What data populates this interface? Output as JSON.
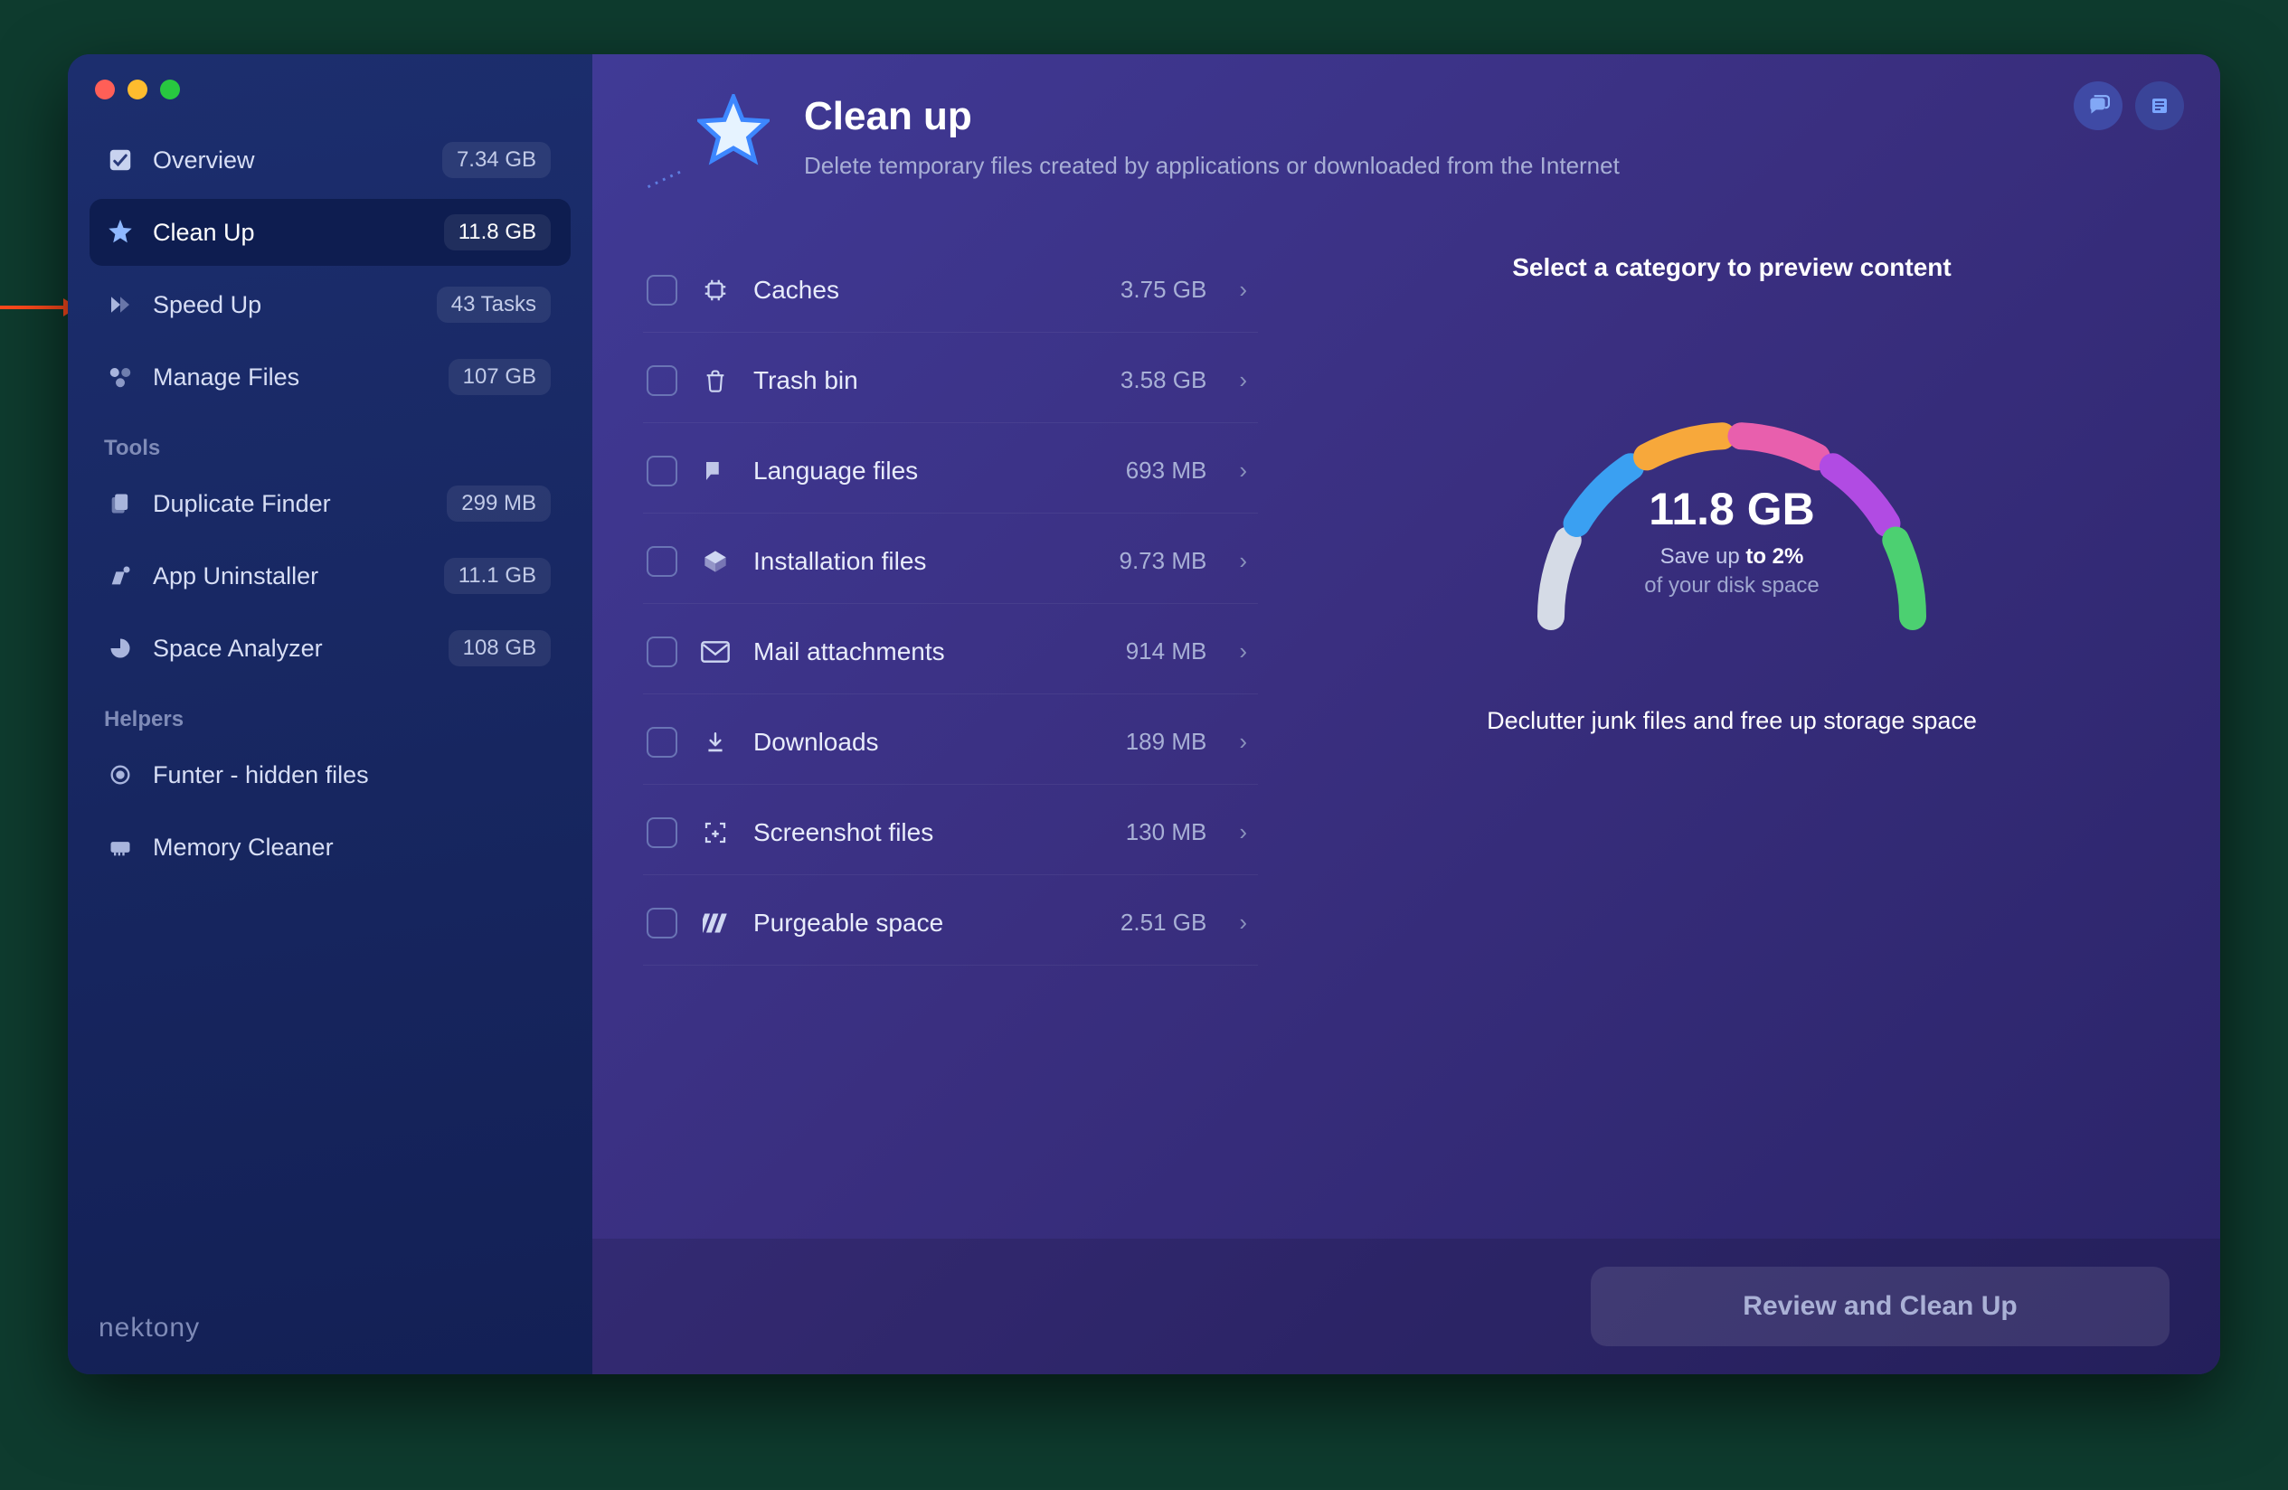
{
  "sidebar": {
    "items": [
      {
        "label": "Overview",
        "badge": "7.34 GB"
      },
      {
        "label": "Clean Up",
        "badge": "11.8 GB"
      },
      {
        "label": "Speed Up",
        "badge": "43 Tasks"
      },
      {
        "label": "Manage Files",
        "badge": "107 GB"
      }
    ],
    "tools_label": "Tools",
    "tools": [
      {
        "label": "Duplicate Finder",
        "badge": "299 MB"
      },
      {
        "label": "App Uninstaller",
        "badge": "11.1 GB"
      },
      {
        "label": "Space Analyzer",
        "badge": "108 GB"
      }
    ],
    "helpers_label": "Helpers",
    "helpers": [
      {
        "label": "Funter - hidden files"
      },
      {
        "label": "Memory Cleaner"
      }
    ],
    "brand": "nektony"
  },
  "header": {
    "title": "Clean up",
    "subtitle": "Delete temporary files created by applications or downloaded from the Internet"
  },
  "categories": [
    {
      "name": "Caches",
      "size": "3.75 GB"
    },
    {
      "name": "Trash bin",
      "size": "3.58 GB"
    },
    {
      "name": "Language files",
      "size": "693 MB"
    },
    {
      "name": "Installation files",
      "size": "9.73 MB"
    },
    {
      "name": "Mail attachments",
      "size": "914 MB"
    },
    {
      "name": "Downloads",
      "size": "189 MB"
    },
    {
      "name": "Screenshot files",
      "size": "130 MB"
    },
    {
      "name": "Purgeable space",
      "size": "2.51 GB"
    }
  ],
  "preview": {
    "title": "Select a category to preview content",
    "value": "11.8 GB",
    "line1_prefix": "Save up ",
    "line1_bold": "to 2%",
    "line2": "of your disk space",
    "subtitle": "Declutter junk files and free up storage space"
  },
  "gauge_colors": [
    "#d5dbe6",
    "#3aa0f2",
    "#f7a83b",
    "#e85fad",
    "#b14be3",
    "#4cd071"
  ],
  "footer": {
    "cta": "Review and Clean Up"
  }
}
